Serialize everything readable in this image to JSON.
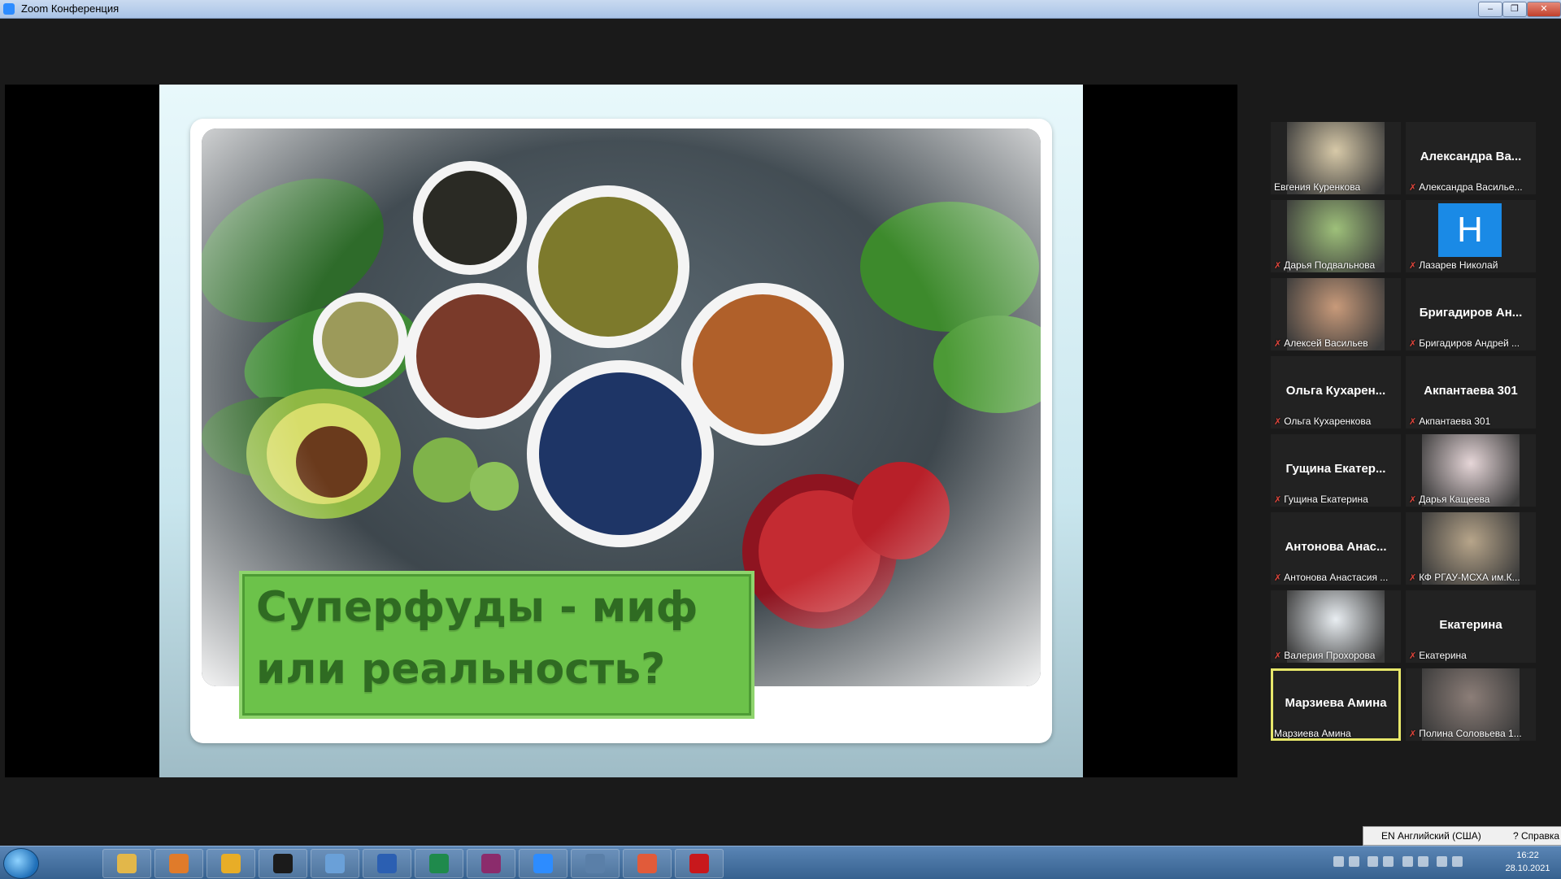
{
  "window": {
    "title": "Zoom Конференция",
    "minimize": "–",
    "restore": "❐",
    "close": "✕"
  },
  "slide": {
    "title_line1": "Суперфуды - миф",
    "title_line2": "или реальность?"
  },
  "participants": [
    {
      "label": "Евгения Куренкова",
      "big": "",
      "muted": false,
      "video": true,
      "color": "#d7c9a8"
    },
    {
      "label": "Александра Василье...",
      "big": "Александра Ва...",
      "muted": true,
      "video": false
    },
    {
      "label": "Дарья Подвальнова",
      "big": "",
      "muted": true,
      "video": true,
      "color": "#9ec07a"
    },
    {
      "label": "Лазарев Николай",
      "big": "",
      "muted": true,
      "video": false,
      "letter": "Н"
    },
    {
      "label": "Алексей Васильев",
      "big": "",
      "muted": true,
      "video": true,
      "color": "#c89a7a"
    },
    {
      "label": "Бригадиров Андрей ...",
      "big": "Бригадиров Ан...",
      "muted": true,
      "video": false
    },
    {
      "label": "Ольга Кухаренкова",
      "big": "Ольга Кухарен...",
      "muted": true,
      "video": false
    },
    {
      "label": "Акпантаева 301",
      "big": "Акпантаева 301",
      "muted": true,
      "video": false
    },
    {
      "label": "Гущина Екатерина",
      "big": "Гущина Екатер...",
      "muted": true,
      "video": false
    },
    {
      "label": "Дарья Кащеева",
      "big": "",
      "muted": true,
      "video": true,
      "color": "#e6d6d8"
    },
    {
      "label": "Антонова Анастасия ...",
      "big": "Антонова Анас...",
      "muted": true,
      "video": false
    },
    {
      "label": "КФ РГАУ-МСХА им.К...",
      "big": "",
      "muted": true,
      "video": true,
      "color": "#b7a58a"
    },
    {
      "label": "Валерия Прохорова",
      "big": "",
      "muted": true,
      "video": true,
      "color": "#e9eef2"
    },
    {
      "label": "Екатерина",
      "big": "Екатерина",
      "muted": true,
      "video": false
    },
    {
      "label": "Марзиева Амина",
      "big": "Марзиева Амина",
      "muted": false,
      "video": false,
      "active": true
    },
    {
      "label": "Полина Соловьева 1...",
      "big": "",
      "muted": true,
      "video": true,
      "color": "#8c7e78"
    }
  ],
  "langbar": {
    "lang": "EN Английский (США)",
    "help": "Справка"
  },
  "clock": {
    "time": "16:22",
    "date": "28.10.2021"
  },
  "taskbar_apps": [
    "Проводник",
    "Медиа",
    "Chrome",
    "Терминал",
    "Paint",
    "Word",
    "Excel",
    "WinRAR",
    "Zoom",
    "Рисунки",
    "Презентация",
    "Adobe Reader"
  ]
}
